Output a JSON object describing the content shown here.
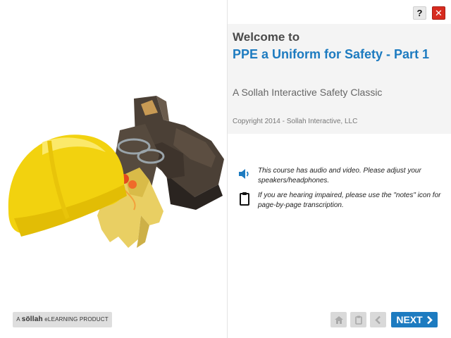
{
  "header": {
    "help_label": "?",
    "close_label": "✕",
    "help_icon": "help-icon",
    "close_icon": "close-icon"
  },
  "title_card": {
    "welcome": "Welcome to",
    "course_title": "PPE a Uniform for Safety - Part 1",
    "subtitle": "A Sollah Interactive Safety Classic",
    "copyright": "Copyright 2014 - Sollah Interactive, LLC"
  },
  "notices": [
    {
      "icon": "speaker-icon",
      "text": "This course has audio and video. Please adjust your speakers/headphones."
    },
    {
      "icon": "clipboard-icon",
      "text": "If you are hearing impaired, please use the \"notes\" icon for page-by-page transcription."
    }
  ],
  "brand": {
    "prefix": "A ",
    "name": "söllah",
    "suffix": " eLEARNING PRODUCT"
  },
  "navigation": {
    "home_icon": "home-icon",
    "notes_icon": "clipboard-icon",
    "back_icon": "chevron-left-icon",
    "next_label": "NEXT",
    "next_icon": "chevron-right-icon"
  },
  "colors": {
    "accent": "#1d7bc0",
    "close": "#d72b1f",
    "band": "#f4f4f4"
  }
}
